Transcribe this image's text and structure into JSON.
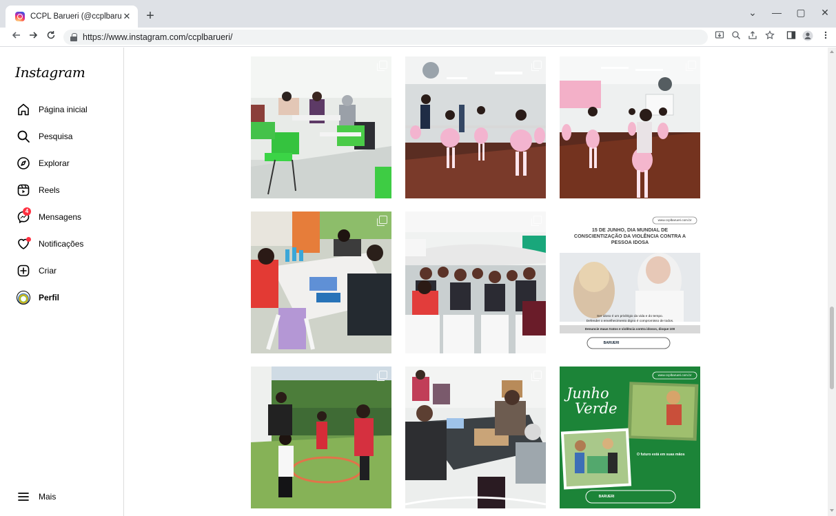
{
  "browser": {
    "tab_title": "CCPL Barueri (@ccplbarueri) • Fot",
    "tab_close": "✕",
    "new_tab": "+",
    "url": "https://www.instagram.com/ccplbarueri/",
    "window_controls": {
      "collapse": "⌄",
      "minimize": "—",
      "maximize": "▢",
      "close": "✕"
    }
  },
  "sidebar": {
    "logo": "Instagram",
    "items": [
      {
        "label": "Página inicial",
        "icon": "home-icon"
      },
      {
        "label": "Pesquisa",
        "icon": "search-icon"
      },
      {
        "label": "Explorar",
        "icon": "compass-icon"
      },
      {
        "label": "Reels",
        "icon": "reels-icon"
      },
      {
        "label": "Mensagens",
        "icon": "messenger-icon",
        "badge": "4"
      },
      {
        "label": "Notificações",
        "icon": "heart-icon"
      },
      {
        "label": "Criar",
        "icon": "plus-square-icon"
      },
      {
        "label": "Perfil",
        "icon": "avatar"
      }
    ],
    "more": "Mais"
  },
  "posters": {
    "idosa": {
      "site": "www.ccplbarueri.com.br",
      "headline": "15 DE JUNHO, DIA MUNDIAL DE CONSCIENTIZAÇÃO DA VIOLÊNCIA CONTRA A PESSOA IDOSA",
      "body1": "Ser idoso é um privilégio da vida e do tempo.",
      "body2": "Defender o envelhecimento digno é compromisso de todos.",
      "denuncie": "Denuncie maus tratos e violência contra idosos, disque 100",
      "barueri": "BARUERI"
    },
    "junho": {
      "site": "www.ccplbarueri.com.br",
      "title1": "Junho",
      "title2": "Verde",
      "tagline": "O futuro está em suas mãos",
      "barueri": "BARUERI"
    }
  },
  "colors": {
    "accent": "#0095f6",
    "badge": "#ff3040",
    "green_poster": "#1f8a3b"
  }
}
